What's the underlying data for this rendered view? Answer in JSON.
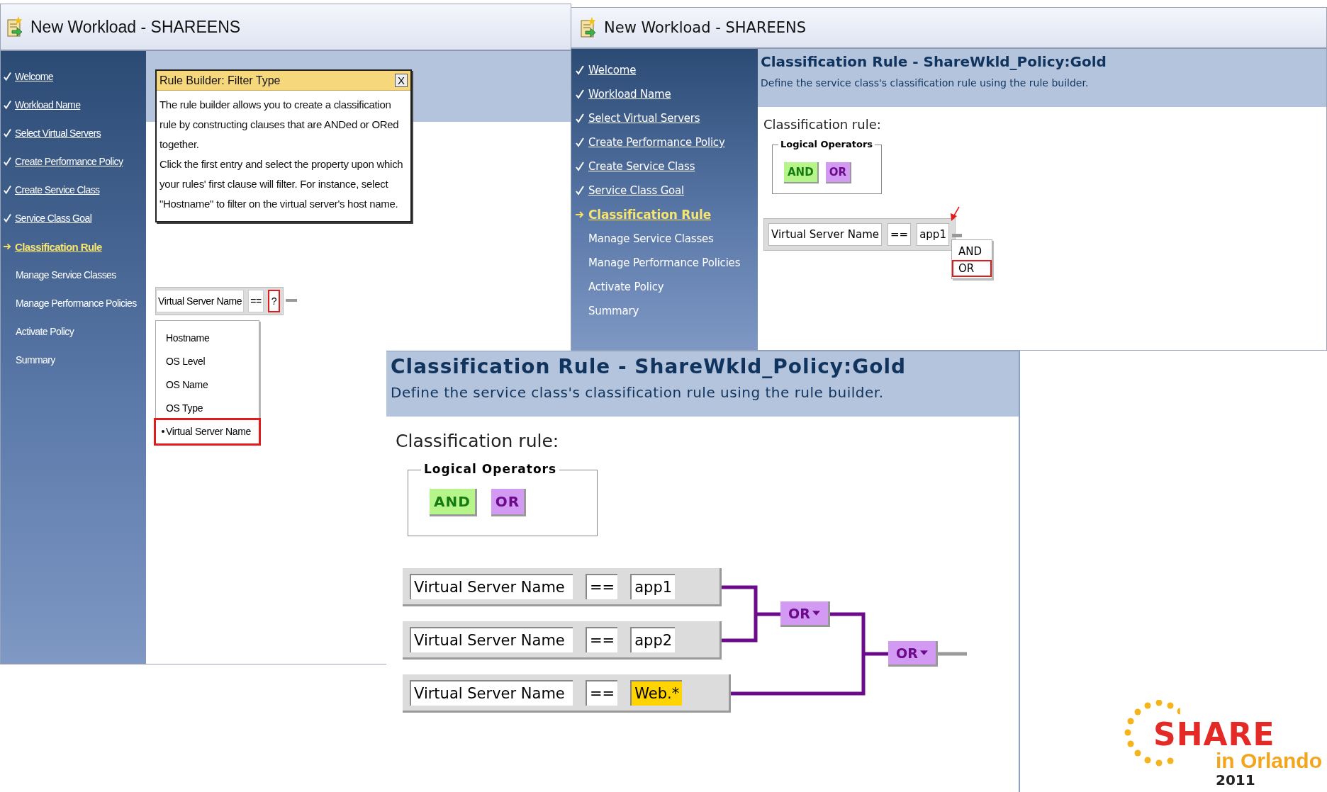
{
  "left_window": {
    "title": "New Workload - SHAREENS",
    "nav": [
      {
        "label": "Welcome",
        "kind": "done"
      },
      {
        "label": "Workload Name",
        "kind": "done"
      },
      {
        "label": "Select Virtual Servers",
        "kind": "done"
      },
      {
        "label": "Create Performance Policy",
        "kind": "done"
      },
      {
        "label": "Create Service Class",
        "kind": "done"
      },
      {
        "label": "Service Class Goal",
        "kind": "done"
      },
      {
        "label": "Classification Rule",
        "kind": "current"
      },
      {
        "label": "Manage Service Classes",
        "kind": "todo"
      },
      {
        "label": "Manage Performance Policies",
        "kind": "todo"
      },
      {
        "label": "Activate Policy",
        "kind": "todo"
      },
      {
        "label": "Summary",
        "kind": "todo"
      }
    ],
    "popup": {
      "title": "Rule Builder: Filter Type",
      "close": "X",
      "paragraphs": [
        "The rule builder allows you to create a classification rule by constructing clauses that are ANDed or ORed together.",
        "Click the first entry and select the property upon which your rules' first clause will filter. For instance, select \"Hostname\" to filter on the virtual server's host name."
      ]
    },
    "clause": {
      "property": "Virtual Server Name",
      "operator": "==",
      "value": "?",
      "highlighted": true
    },
    "dropdown": [
      {
        "label": "Hostname",
        "selected": false
      },
      {
        "label": "OS Level",
        "selected": false
      },
      {
        "label": "OS Name",
        "selected": false
      },
      {
        "label": "OS Type",
        "selected": false
      },
      {
        "label": "Virtual Server Name",
        "selected": true
      }
    ]
  },
  "right_window": {
    "title": "New Workload - SHAREENS",
    "nav": [
      {
        "label": "Welcome",
        "kind": "done"
      },
      {
        "label": "Workload Name",
        "kind": "done"
      },
      {
        "label": "Select Virtual Servers",
        "kind": "done"
      },
      {
        "label": "Create Performance Policy",
        "kind": "done"
      },
      {
        "label": "Create Service Class",
        "kind": "done"
      },
      {
        "label": "Service Class Goal",
        "kind": "done"
      },
      {
        "label": "Classification Rule",
        "kind": "current"
      },
      {
        "label": "Manage Service Classes",
        "kind": "todo"
      },
      {
        "label": "Manage Performance Policies",
        "kind": "todo"
      },
      {
        "label": "Activate Policy",
        "kind": "todo"
      },
      {
        "label": "Summary",
        "kind": "todo"
      }
    ],
    "heading": "Classification Rule - ShareWkld_Policy:Gold",
    "description": "Define the service class's classification rule using the rule builder.",
    "rule_label": "Classification rule:",
    "legend": "Logical Operators",
    "operators": [
      {
        "label": "AND",
        "kind": "and"
      },
      {
        "label": "OR",
        "kind": "or"
      }
    ],
    "clause": {
      "property": "Virtual Server Name",
      "operator": "==",
      "value": "app1",
      "highlighted": false
    },
    "menu": [
      {
        "label": "AND",
        "selected": false
      },
      {
        "label": "OR",
        "selected": true
      }
    ]
  },
  "detail_view": {
    "heading": "Classification Rule - ShareWkld_Policy:Gold",
    "description": "Define the service class's classification rule using the rule builder.",
    "rule_label": "Classification rule:",
    "legend": "Logical Operators",
    "operators": [
      {
        "label": "AND",
        "kind": "and"
      },
      {
        "label": "OR",
        "kind": "or"
      }
    ],
    "clauses": [
      {
        "property": "Virtual Server Name",
        "operator": "==",
        "value": "app1",
        "highlighted": false
      },
      {
        "property": "Virtual Server Name",
        "operator": "==",
        "value": "app2",
        "highlighted": false
      },
      {
        "property": "Virtual Server Name",
        "operator": "==",
        "value": "Web.*",
        "highlighted": true
      }
    ],
    "combinators": [
      {
        "label": "OR",
        "kind": "or"
      },
      {
        "label": "OR",
        "kind": "or"
      }
    ]
  },
  "logo": {
    "name": "SHARE",
    "place": "in Orlando",
    "year": "2011"
  }
}
